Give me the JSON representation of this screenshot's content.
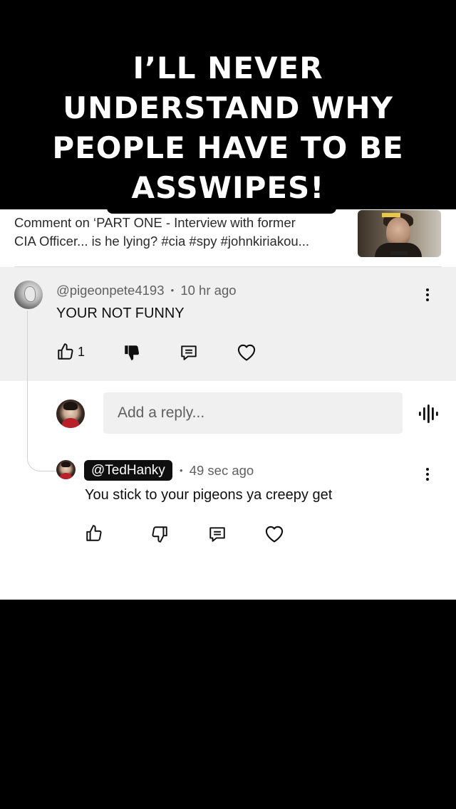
{
  "caption": {
    "lines": [
      "I’LL NEVER",
      "UNDERSTAND WHY",
      "PEOPLE HAVE TO BE",
      "ASSWIPES!"
    ]
  },
  "video_context": {
    "line1": "Comment on ‘PART ONE - Interview with former",
    "line2": "CIA Officer... is he lying? #cia #spy #johnkiriakou...",
    "thumbnail_icon": "video-thumbnail-icon"
  },
  "parent_comment": {
    "username": "@pigeonpete4193",
    "separator": "•",
    "time": "10 hr ago",
    "text": "YOUR NOT FUNNY",
    "like_count": "1"
  },
  "reply_box": {
    "placeholder": "Add a reply..."
  },
  "reply_comment": {
    "username": "@TedHanky",
    "separator": "•",
    "time": "49 sec ago",
    "text": "You stick to your pigeons ya creepy get"
  },
  "colors": {
    "caption_bg": "#000000",
    "caption_text": "#ffffff",
    "parent_highlight": "#f0f0f0",
    "text_primary": "#0f0f0f",
    "text_secondary": "#606060"
  }
}
